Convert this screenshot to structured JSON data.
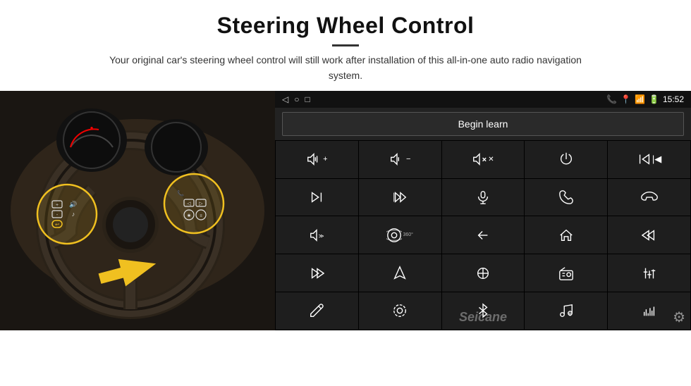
{
  "header": {
    "title": "Steering Wheel Control",
    "subtitle": "Your original car's steering wheel control will still work after installation of this all-in-one auto radio navigation system."
  },
  "status_bar": {
    "time": "15:52",
    "nav_back": "◁",
    "nav_home": "○",
    "nav_recent": "□"
  },
  "begin_learn": {
    "label": "Begin learn"
  },
  "icons": [
    {
      "id": "vol-up",
      "title": "Volume Up"
    },
    {
      "id": "vol-down",
      "title": "Volume Down"
    },
    {
      "id": "mute",
      "title": "Mute"
    },
    {
      "id": "power",
      "title": "Power"
    },
    {
      "id": "prev-track-skip",
      "title": "Previous/Skip"
    },
    {
      "id": "next-track",
      "title": "Next Track"
    },
    {
      "id": "ff-skip",
      "title": "Fast Forward"
    },
    {
      "id": "mic",
      "title": "Microphone"
    },
    {
      "id": "phone",
      "title": "Phone"
    },
    {
      "id": "hang-up",
      "title": "Hang Up"
    },
    {
      "id": "speaker",
      "title": "Speaker"
    },
    {
      "id": "360-camera",
      "title": "360 Camera"
    },
    {
      "id": "back",
      "title": "Back"
    },
    {
      "id": "home",
      "title": "Home"
    },
    {
      "id": "rewind",
      "title": "Rewind"
    },
    {
      "id": "next-fast",
      "title": "Next Fast"
    },
    {
      "id": "navigation",
      "title": "Navigation"
    },
    {
      "id": "source",
      "title": "Source"
    },
    {
      "id": "radio",
      "title": "Radio"
    },
    {
      "id": "equalizer",
      "title": "Equalizer"
    },
    {
      "id": "pen",
      "title": "Pen/Write"
    },
    {
      "id": "settings-round",
      "title": "Settings Round"
    },
    {
      "id": "bluetooth",
      "title": "Bluetooth"
    },
    {
      "id": "music",
      "title": "Music"
    },
    {
      "id": "spectrum",
      "title": "Spectrum"
    }
  ],
  "watermark": "Seicane"
}
